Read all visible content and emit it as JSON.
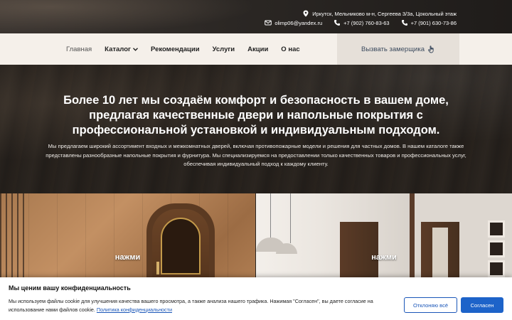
{
  "topbar": {
    "address": "Иркутск, Мельниково м-н, Сергеева 3/3а, Цокольный этаж",
    "email": "olimp06@yandex.ru",
    "phone1": "+7 (902) 760-83-63",
    "phone2": "+7 (901) 630-73-86",
    "address_icon": "map-pin-icon",
    "email_icon": "envelope-icon",
    "phone_icon": "phone-icon"
  },
  "nav": {
    "items": [
      {
        "label": "Главная"
      },
      {
        "label": "Каталог"
      },
      {
        "label": "Рекомендации"
      },
      {
        "label": "Услуги"
      },
      {
        "label": "Акции"
      },
      {
        "label": "О нас"
      }
    ],
    "callout": "Вызвать замерщика",
    "callout_icon": "hand-pointer-icon"
  },
  "hero": {
    "title": "Более 10 лет мы создаём комфорт и безопасность в вашем доме, предлагая качественные двери и напольные покрытия с профессиональной установкой и индивидуальным подходом.",
    "text": "Мы предлагаем широкий ассортимент входных и межкомнатных дверей, включая противопожарные модели и решения для частных домов. В нашем каталоге также представлены разнообразные напольные покрытия и фурнитура. Мы специализируемся на предоставлении только качественных товаров и профессиональных услуг, обеспечивая индивидуальный подход к каждому клиенту."
  },
  "tiles": [
    {
      "label": "нажми"
    },
    {
      "label": "нажми"
    }
  ],
  "cookie": {
    "title": "Мы ценим вашу конфиденциальность",
    "text": "Мы используем файлы cookie для улучшения качества вашего просмотра, а также анализа нашего трафика. Нажимая \"Согласен\", вы даете согласие на использование нами файлов cookie.",
    "link": "Политика конфиденциальности",
    "reject": "Отклоняю всё",
    "accept": "Согласен"
  },
  "colors": {
    "accent": "#1d63c9",
    "nav_bg": "#f5f0ea",
    "callout_bg": "#e6e0d9"
  }
}
